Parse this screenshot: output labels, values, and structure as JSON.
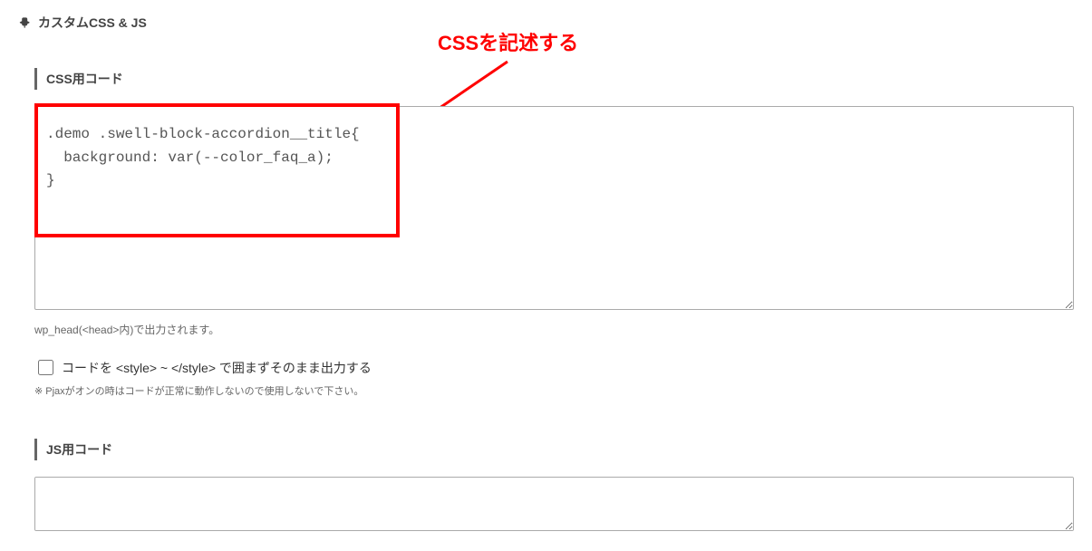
{
  "panel": {
    "title": "カスタムCSS & JS"
  },
  "annotation": "CSSを記述する",
  "css_section": {
    "label": "CSS用コード",
    "value": ".demo .swell-block-accordion__title{\n  background: var(--color_faq_a);\n}",
    "hint": "wp_head(<head>内)で出力されます。",
    "checkbox_label": "コードを <style> ~ </style> で囲まずそのまま出力する",
    "note": "※ Pjaxがオンの時はコードが正常に動作しないので使用しないで下さい。"
  },
  "js_section": {
    "label": "JS用コード",
    "value": ""
  }
}
